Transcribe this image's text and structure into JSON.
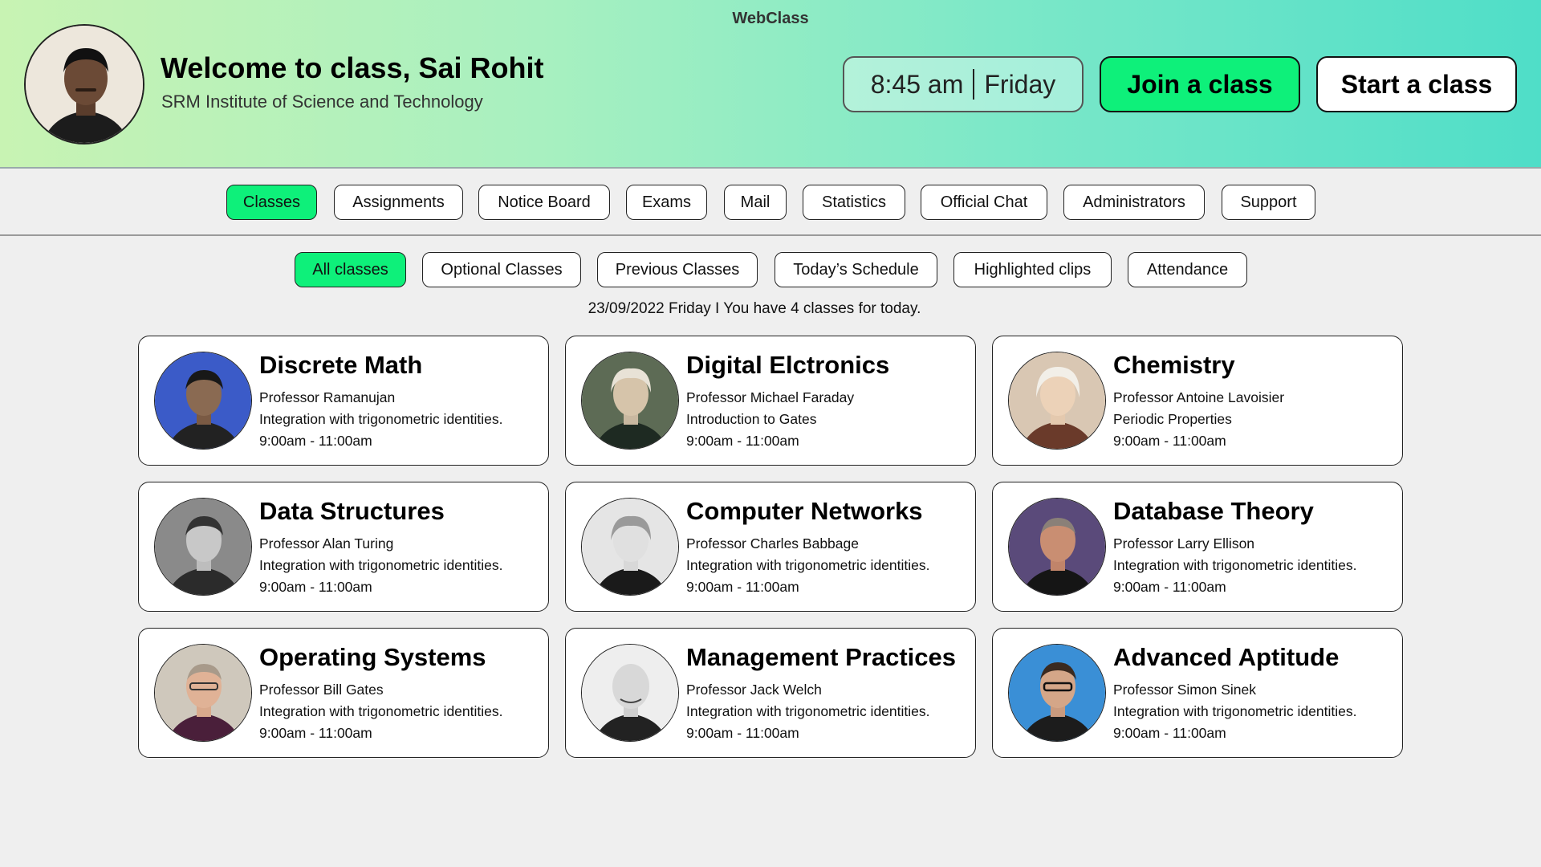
{
  "app": {
    "title": "WebClass"
  },
  "user": {
    "welcome": "Welcome to class, Sai Rohit",
    "institute": "SRM Institute of Science and Technology"
  },
  "clock": {
    "time": "8:45 am",
    "day": "Friday"
  },
  "actions": {
    "join": "Join a class",
    "start": "Start a class"
  },
  "main_nav": [
    {
      "label": "Classes",
      "active": true
    },
    {
      "label": "Assignments"
    },
    {
      "label": "Notice Board"
    },
    {
      "label": "Exams"
    },
    {
      "label": "Mail"
    },
    {
      "label": "Statistics"
    },
    {
      "label": "Official Chat"
    },
    {
      "label": "Administrators"
    },
    {
      "label": "Support"
    }
  ],
  "sub_nav": [
    {
      "label": "All classes",
      "active": true
    },
    {
      "label": "Optional Classes"
    },
    {
      "label": "Previous Classes"
    },
    {
      "label": "Today’s Schedule"
    },
    {
      "label": "Highlighted clips"
    },
    {
      "label": "Attendance"
    }
  ],
  "summary": "23/09/2022 Friday I You have 4 classes for today.",
  "colors": {
    "accent": "#0ef07a",
    "header_left": "#c8f3b3",
    "header_right": "#4fdec8"
  },
  "classes": [
    {
      "subject": "Discrete Math",
      "professor": "Professor Ramanujan",
      "topic": "Integration with trigonometric identities.",
      "time": "9:00am - 11:00am",
      "photo_bg": "#3b5bc8"
    },
    {
      "subject": "Digital Elctronics",
      "professor": "Professor Michael Faraday",
      "topic": "Introduction to Gates",
      "time": "9:00am - 11:00am",
      "photo_bg": "#5d6b55"
    },
    {
      "subject": "Chemistry",
      "professor": "Professor Antoine Lavoisier",
      "topic": "Periodic Properties",
      "time": "9:00am - 11:00am",
      "photo_bg": "#d9c7b3"
    },
    {
      "subject": "Data Structures",
      "professor": "Professor Alan Turing",
      "topic": "Integration with trigonometric identities.",
      "time": "9:00am - 11:00am",
      "photo_bg": "#8a8a8a"
    },
    {
      "subject": "Computer Networks",
      "professor": "Professor Charles Babbage",
      "topic": "Integration with trigonometric identities.",
      "time": "9:00am - 11:00am",
      "photo_bg": "#e5e5e5"
    },
    {
      "subject": "Database Theory",
      "professor": "Professor Larry Ellison",
      "topic": "Integration with trigonometric identities.",
      "time": "9:00am - 11:00am",
      "photo_bg": "#5a4a7a"
    },
    {
      "subject": "Operating Systems",
      "professor": "Professor Bill Gates",
      "topic": "Integration with trigonometric identities.",
      "time": "9:00am - 11:00am",
      "photo_bg": "#cfc8bc"
    },
    {
      "subject": "Management Practices",
      "professor": "Professor Jack Welch",
      "topic": "Integration with trigonometric identities.",
      "time": "9:00am - 11:00am",
      "photo_bg": "#eeeeee"
    },
    {
      "subject": "Advanced Aptitude",
      "professor": "Professor Simon Sinek",
      "topic": "Integration with trigonometric identities.",
      "time": "9:00am - 11:00am",
      "photo_bg": "#3a8fd6"
    }
  ]
}
